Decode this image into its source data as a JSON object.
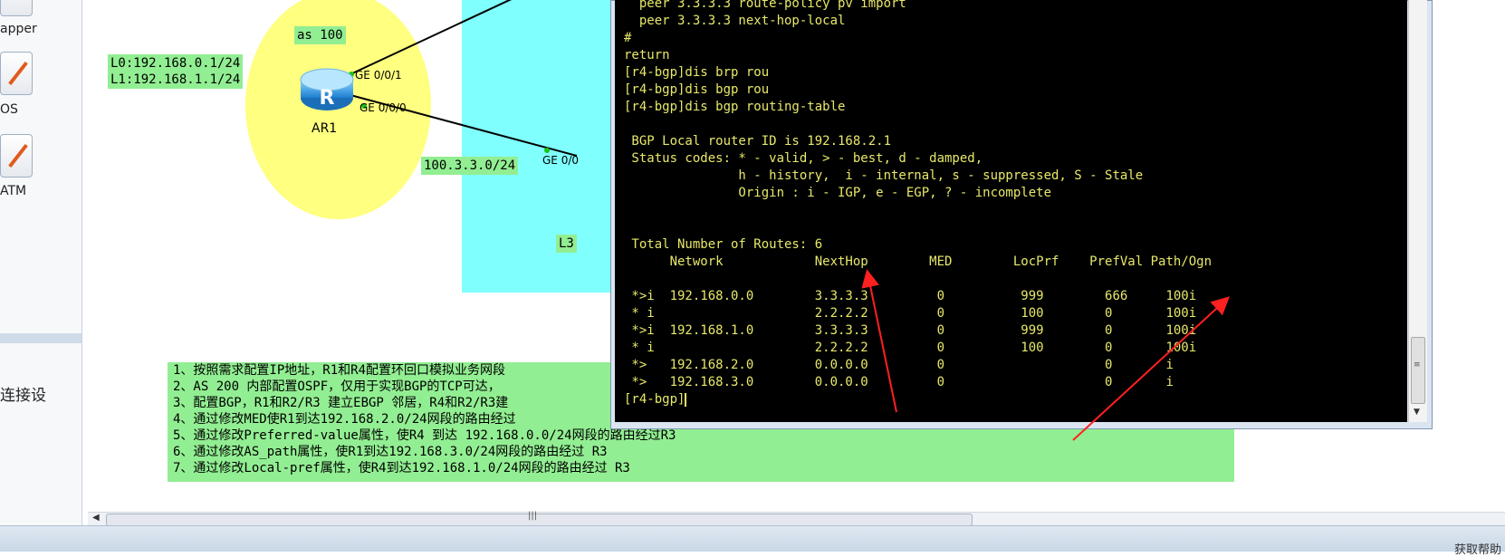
{
  "left_panel": {
    "devices": [
      {
        "label": "apper"
      },
      {
        "label": "OS"
      },
      {
        "label": "ATM"
      }
    ],
    "side_text": "连接设"
  },
  "topology": {
    "as_label": "as 100",
    "loopback_labels": [
      "L0:192.168.0.1/24",
      "L1:192.168.1.1/24"
    ],
    "router": {
      "name": "AR1",
      "glyph": "R"
    },
    "ports": [
      "GE 0/0/1",
      "GE 0/0/0",
      "GE 0/0"
    ],
    "link_label": "100.3.3.0/24",
    "partial_label": "L3",
    "tasks": [
      "1、按照需求配置IP地址，R1和R4配置环回口模拟业务网段",
      "2、AS 200 内部配置OSPF，仅用于实现BGP的TCP可达，",
      "3、配置BGP，R1和R2/R3 建立EBGP 邻居，R4和R2/R3建",
      "4、通过修改MED使R1到达192.168.2.0/24网段的路由经过",
      "5、通过修改Preferred-value属性，使R4 到达 192.168.0.0/24网段的路由经过R3",
      "6、通过修改AS_path属性，使R1到达192.168.3.0/24网段的路由经过 R3",
      "7、通过修改Local-pref属性，使R4到达192.168.1.0/24网段的路由经过 R3"
    ]
  },
  "terminal": {
    "lines": [
      "  peer 3.3.3.3 route-policy pv import",
      "  peer 3.3.3.3 next-hop-local",
      "#",
      "return",
      "[r4-bgp]dis brp rou",
      "[r4-bgp]dis bgp rou",
      "[r4-bgp]dis bgp routing-table",
      "",
      " BGP Local router ID is 192.168.2.1",
      " Status codes: * - valid, > - best, d - damped,",
      "               h - history,  i - internal, s - suppressed, S - Stale",
      "               Origin : i - IGP, e - EGP, ? - incomplete",
      "",
      "",
      " Total Number of Routes: 6",
      "      Network            NextHop        MED        LocPrf    PrefVal Path/Ogn",
      "",
      " *>i  192.168.0.0        3.3.3.3         0          999        666     100i",
      " * i                     2.2.2.2         0          100        0       100i",
      " *>i  192.168.1.0        3.3.3.3         0          999        0       100i",
      " * i                     2.2.2.2         0          100        0       100i",
      " *>   192.168.2.0        0.0.0.0         0                     0       i",
      " *>   192.168.3.0        0.0.0.0         0                     0       i"
    ],
    "prompt": "[r4-bgp]"
  },
  "status_bar": {
    "help_text": "获取帮助"
  },
  "colors": {
    "terminal_text": "#e8e86a",
    "label_green": "#92ee92",
    "area_yellow": "#ffff80",
    "area_cyan": "#80ffff",
    "arrow_red": "#ff2020"
  },
  "icons": {
    "router": "router-icon",
    "devices": "device-connector-icon"
  }
}
